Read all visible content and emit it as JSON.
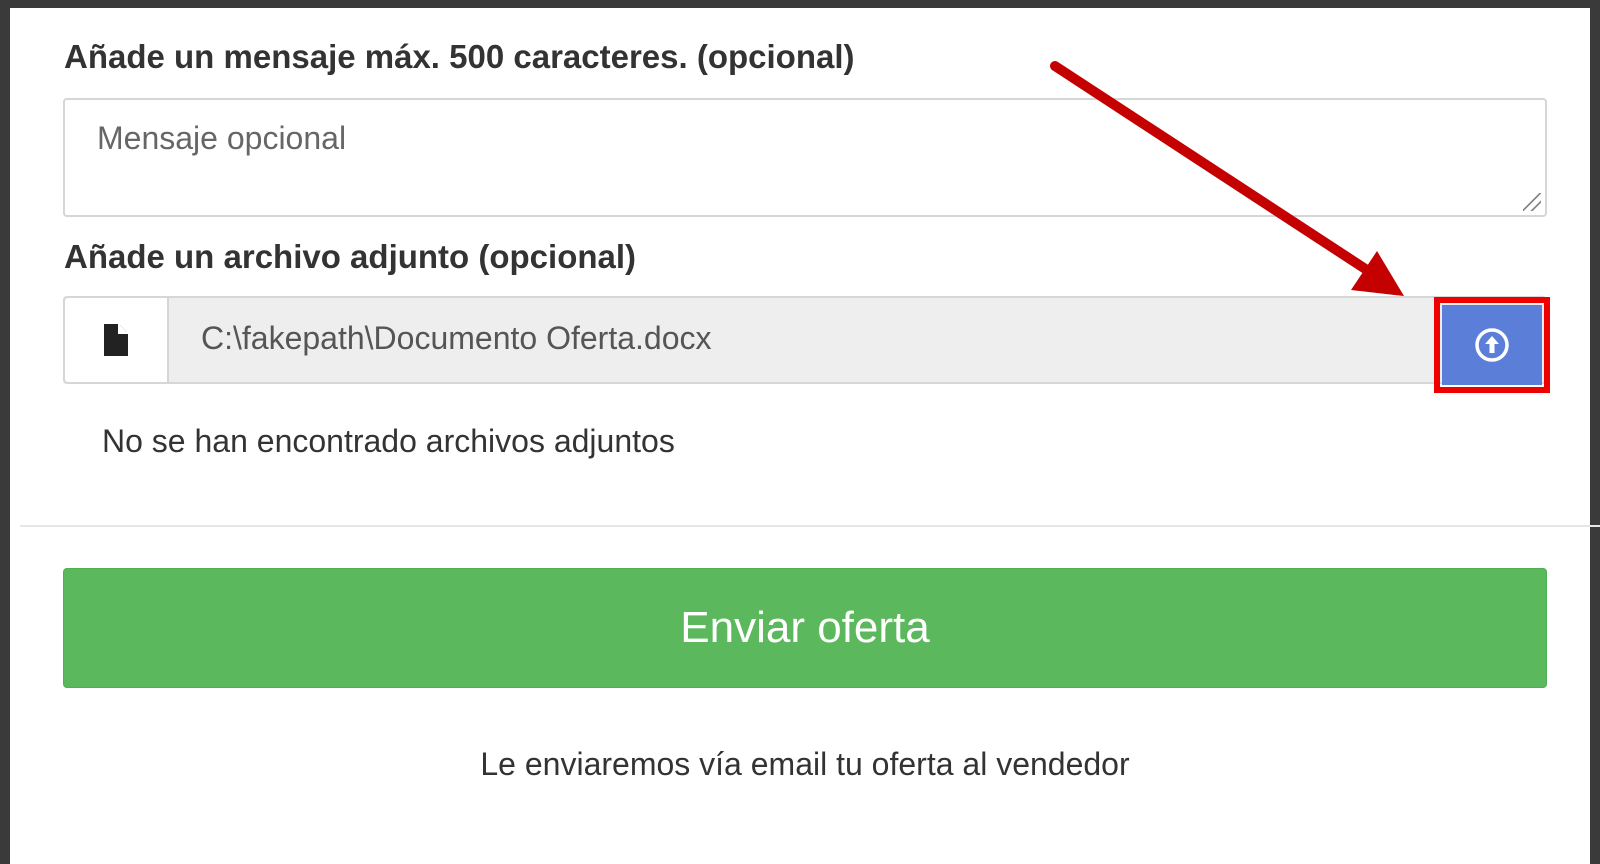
{
  "form": {
    "message_label": "Añade un mensaje máx. 500 caracteres. (opcional)",
    "message_placeholder": "Mensaje opcional",
    "attachment_label": "Añade un archivo adjunto (opcional)",
    "file_path": "C:\\fakepath\\Documento Oferta.docx",
    "no_attachments_text": "No se han encontrado archivos adjuntos",
    "submit_label": "Enviar oferta",
    "footer_note": "Le enviaremos vía email tu oferta al vendedor"
  },
  "icons": {
    "file": "file-icon",
    "upload": "arrow-circle-up-icon",
    "annotation": "red-arrow"
  },
  "colors": {
    "submit_button": "#5cb85c",
    "upload_button": "#5b7fd8",
    "highlight": "#ee0000",
    "annotation_arrow": "#c40000"
  }
}
